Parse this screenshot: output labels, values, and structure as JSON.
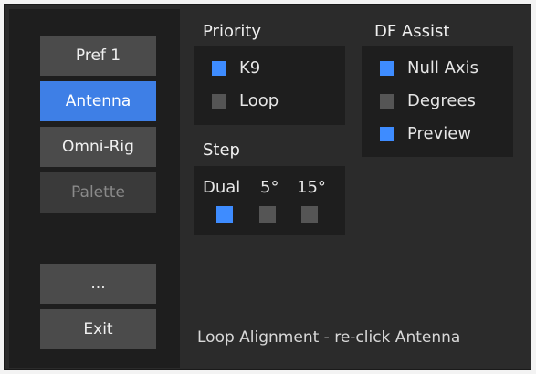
{
  "sidebar": {
    "buttons": [
      {
        "label": "Pref 1",
        "state": "normal"
      },
      {
        "label": "Antenna",
        "state": "active"
      },
      {
        "label": "Omni-Rig",
        "state": "normal"
      },
      {
        "label": "Palette",
        "state": "disabled"
      },
      {
        "label": "...",
        "state": "normal"
      },
      {
        "label": "Exit",
        "state": "normal"
      }
    ]
  },
  "priority": {
    "title": "Priority",
    "options": [
      {
        "label": "K9",
        "checked": true
      },
      {
        "label": "Loop",
        "checked": false
      }
    ]
  },
  "df_assist": {
    "title": "DF Assist",
    "options": [
      {
        "label": "Null Axis",
        "checked": true
      },
      {
        "label": "Degrees",
        "checked": false
      },
      {
        "label": "Preview",
        "checked": true
      }
    ]
  },
  "step": {
    "title": "Step",
    "options": [
      {
        "label": "Dual",
        "checked": true
      },
      {
        "label": "5°",
        "checked": false
      },
      {
        "label": "15°",
        "checked": false
      }
    ]
  },
  "footer": {
    "text": "Loop Alignment - re-click Antenna"
  },
  "colors": {
    "accent": "#3e8cff",
    "active_button": "#3e7fe6",
    "unchecked": "#555555"
  }
}
